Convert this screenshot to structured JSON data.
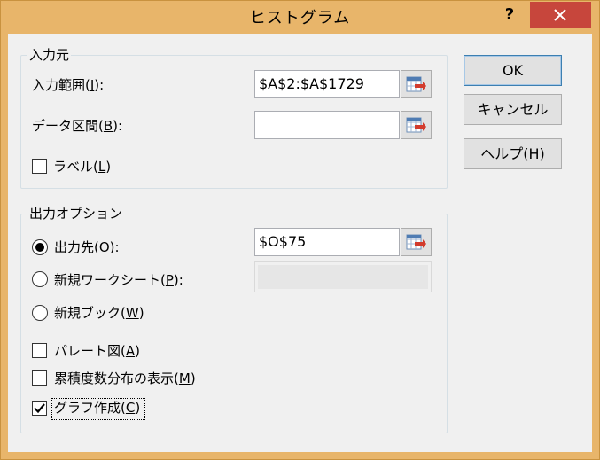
{
  "window": {
    "title": "ヒストグラム",
    "help_label": "?",
    "close_icon": "close-icon"
  },
  "input_group": {
    "title": "入力元",
    "input_range": {
      "label": "入力範囲(",
      "mnemonic": "I",
      "suffix": "):",
      "value": "$A$2:$A$1729"
    },
    "bin_range": {
      "label": "データ区間(",
      "mnemonic": "B",
      "suffix": "):",
      "value": ""
    },
    "labels": {
      "label": "ラベル(",
      "mnemonic": "L",
      "suffix": ")",
      "checked": false
    }
  },
  "output_group": {
    "title": "出力オプション",
    "output_range": {
      "label": "出力先(",
      "mnemonic": "O",
      "suffix": "):",
      "value": "$O$75",
      "selected": true
    },
    "new_worksheet": {
      "label": "新規ワークシート(",
      "mnemonic": "P",
      "suffix": "):",
      "value": "",
      "selected": false
    },
    "new_workbook": {
      "label": "新規ブック(",
      "mnemonic": "W",
      "suffix": ")",
      "selected": false
    },
    "pareto": {
      "label": "パレート図(",
      "mnemonic": "A",
      "suffix": ")",
      "checked": false
    },
    "cumulative": {
      "label": "累積度数分布の表示(",
      "mnemonic": "M",
      "suffix": ")",
      "checked": false
    },
    "chart_output": {
      "label": "グラフ作成(",
      "mnemonic": "C",
      "suffix": ")",
      "checked": true
    }
  },
  "buttons": {
    "ok": "OK",
    "cancel": "キャンセル",
    "help": {
      "label": "ヘルプ(",
      "mnemonic": "H",
      "suffix": ")"
    }
  },
  "icons": {
    "range_selector": "range-selector-icon",
    "checkmark": "checkmark-icon"
  },
  "colors": {
    "titlebar": "#e8b56a",
    "close_button": "#c7463c",
    "client": "#f0f0f0",
    "default_button_border": "#3c7fb1"
  }
}
